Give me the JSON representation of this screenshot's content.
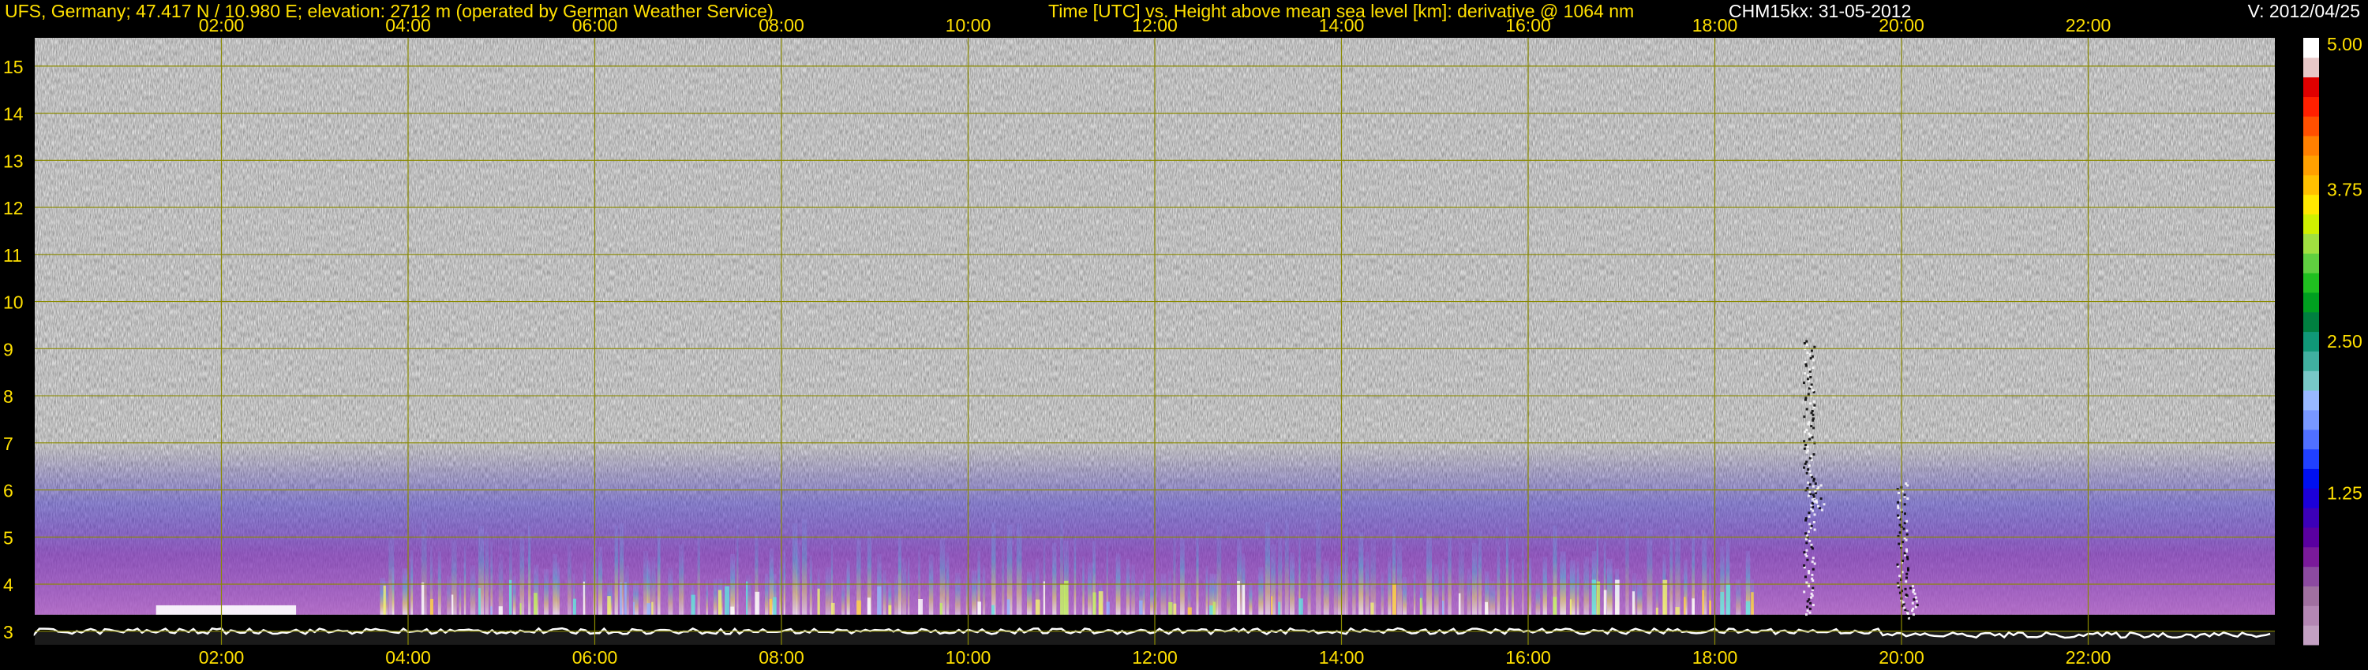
{
  "header": {
    "station": "UFS, Germany; 47.417 N / 10.980 E; elevation: 2712 m  (operated by German Weather Service)",
    "axes_title": "Time [UTC] vs. Height above mean sea level [km]: derivative @ 1064 nm",
    "instrument_date": "CHM15kx: 31-05-2012",
    "version": "V: 2012/04/25"
  },
  "colors": {
    "label_yellow": "#ffe000",
    "grid_yellow": "#8a8a00",
    "background": "#000000",
    "noise_gray": "#8f8f8f"
  },
  "chart_data": {
    "type": "heatmap",
    "title": "Time [UTC] vs. Height above mean sea level [km]: derivative @ 1064 nm",
    "x_ticks": [
      "02:00",
      "04:00",
      "06:00",
      "08:00",
      "10:00",
      "12:00",
      "14:00",
      "16:00",
      "18:00",
      "20:00",
      "22:00"
    ],
    "x_tick_hours": [
      2,
      4,
      6,
      8,
      10,
      12,
      14,
      16,
      18,
      20,
      22
    ],
    "xlim_hours": [
      0,
      24
    ],
    "y_ticks": [
      "3",
      "4",
      "5",
      "6",
      "7",
      "8",
      "9",
      "10",
      "11",
      "12",
      "13",
      "14",
      "15"
    ],
    "y_tick_values": [
      3,
      4,
      5,
      6,
      7,
      8,
      9,
      10,
      11,
      12,
      13,
      14,
      15
    ],
    "ylim_km": [
      2.712,
      15.6
    ],
    "grid": true,
    "colorbar": {
      "ticks": [
        "1.25",
        "2.50",
        "3.75",
        "5.00"
      ],
      "tick_values": [
        1.25,
        2.5,
        3.75,
        5.0
      ],
      "range": [
        0,
        5.0
      ],
      "colors": [
        "#c3a0c3",
        "#b487b4",
        "#a070a0",
        "#8c4aa0",
        "#7a1a9a",
        "#5a00a0",
        "#3c00b8",
        "#1c00d8",
        "#0010f0",
        "#2040ff",
        "#5070ff",
        "#7898ff",
        "#98b8ff",
        "#78c8c8",
        "#40b0a0",
        "#109878",
        "#008040",
        "#00a020",
        "#20c020",
        "#60d040",
        "#a0e040",
        "#d0f000",
        "#ffe800",
        "#ffc000",
        "#ffa000",
        "#ff8000",
        "#ff5000",
        "#ff2000",
        "#e00000",
        "#e8c8c8",
        "#ffffff"
      ]
    },
    "features": {
      "surface_layer_top_km": 3.35,
      "aerosol_layer_top_km": 7.0,
      "bright_layer_start_hour": 3.7,
      "bright_layer_end_hour": 18.4,
      "cloud_plume_hours": [
        19.0,
        20.0
      ]
    }
  }
}
